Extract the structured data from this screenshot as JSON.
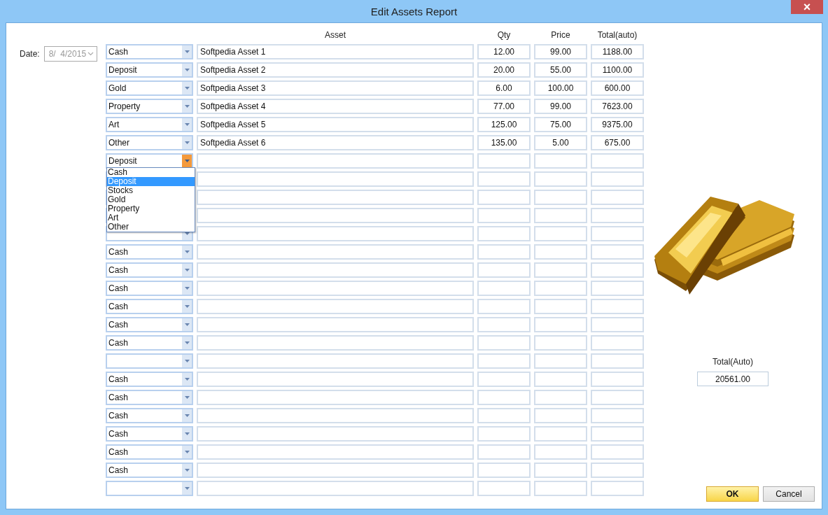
{
  "window": {
    "title": "Edit Assets Report",
    "close": "×"
  },
  "date": {
    "label": "Date:",
    "value": "8/  4/2015",
    "disabled": true
  },
  "table": {
    "columns": [
      "Asset",
      "Qty",
      "Price",
      "Total(auto)"
    ],
    "rows": [
      {
        "type": "Cash",
        "asset": "Softpedia Asset 1",
        "qty": "12.00",
        "price": "99.00",
        "total": "1188.00",
        "open": false
      },
      {
        "type": "Deposit",
        "asset": "Softpedia Asset 2",
        "qty": "20.00",
        "price": "55.00",
        "total": "1100.00",
        "open": false
      },
      {
        "type": "Gold",
        "asset": "Softpedia Asset 3",
        "qty": "6.00",
        "price": "100.00",
        "total": "600.00",
        "open": false
      },
      {
        "type": "Property",
        "asset": "Softpedia Asset 4",
        "qty": "77.00",
        "price": "99.00",
        "total": "7623.00",
        "open": false
      },
      {
        "type": "Art",
        "asset": "Softpedia Asset 5",
        "qty": "125.00",
        "price": "75.00",
        "total": "9375.00",
        "open": false
      },
      {
        "type": "Other",
        "asset": "Softpedia Asset 6",
        "qty": "135.00",
        "price": "5.00",
        "total": "675.00",
        "open": false
      },
      {
        "type": "Deposit",
        "open": true
      },
      {},
      {},
      {},
      {
        "open": false
      },
      {
        "type": "Cash",
        "open": false
      },
      {
        "type": "Cash",
        "open": false
      },
      {
        "type": "Cash",
        "open": false
      },
      {
        "type": "Cash",
        "open": false
      },
      {
        "type": "Cash",
        "open": false
      },
      {
        "type": "Cash",
        "open": false
      },
      {
        "open": false
      },
      {
        "type": "Cash",
        "open": false
      },
      {
        "type": "Cash",
        "open": false
      },
      {
        "type": "Cash",
        "open": false
      },
      {
        "type": "Cash",
        "open": false
      },
      {
        "type": "Cash",
        "open": false
      },
      {
        "type": "Cash",
        "open": false
      },
      {
        "open": false
      }
    ]
  },
  "dropdown": {
    "options": [
      {
        "label": "Cash",
        "selected": false
      },
      {
        "label": "Deposit",
        "selected": true
      },
      {
        "label": "Stocks",
        "selected": false
      },
      {
        "label": "Gold",
        "selected": false
      },
      {
        "label": "Property",
        "selected": false
      },
      {
        "label": "Art",
        "selected": false
      },
      {
        "label": "Other",
        "selected": false
      }
    ]
  },
  "summary": {
    "label": "Total(Auto)",
    "value": "20561.00"
  },
  "buttons": [
    {
      "label": "OK",
      "kind": "default"
    },
    {
      "label": "Cancel",
      "kind": "normal"
    }
  ]
}
